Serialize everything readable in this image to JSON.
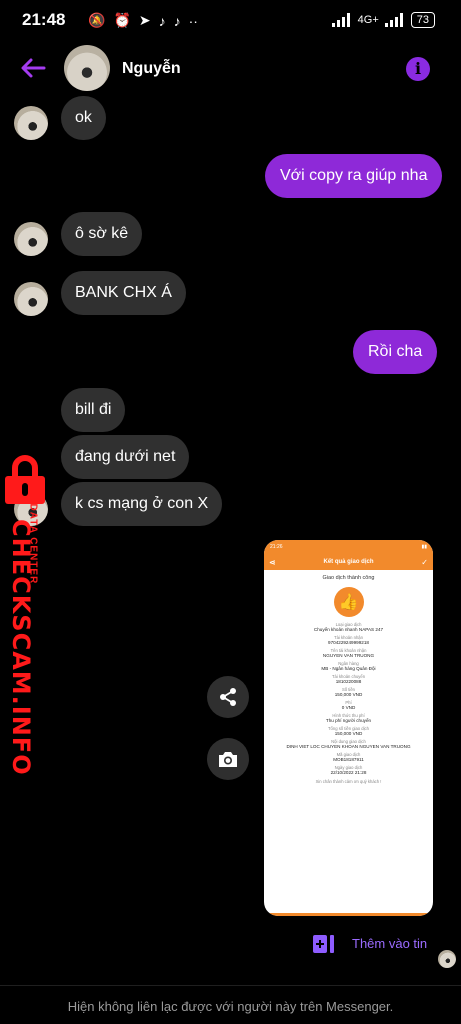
{
  "status_bar": {
    "time": "21:48",
    "network": "4G+",
    "battery": "73"
  },
  "header": {
    "contact_name": "Nguyễn",
    "back_icon": "arrow-left-icon",
    "info_icon": "info-icon",
    "accent_color": "#8e29d8"
  },
  "messages": [
    {
      "direction": "in",
      "text": "ok"
    },
    {
      "direction": "out",
      "text": "Với copy ra giúp nha"
    },
    {
      "direction": "in",
      "text": "ô sờ kê"
    },
    {
      "direction": "in",
      "text": "BANK CHX Á"
    },
    {
      "direction": "out",
      "text": "Rồi cha"
    },
    {
      "direction": "in",
      "text": "bill đi"
    },
    {
      "direction": "in",
      "text": "đang dưới net"
    },
    {
      "direction": "in",
      "text": "k cs mạng ở con X"
    }
  ],
  "receipt": {
    "time": "21:26",
    "title": "Kết quả giao dịch",
    "status": "Giao dịch thành công",
    "fields": [
      {
        "label": "Loại giao dịch",
        "value": "Chuyển khoản nhanh NAPAS 247"
      },
      {
        "label": "Tài khoản nhận",
        "value": "9704229249999218"
      },
      {
        "label": "Tên tài khoản nhận",
        "value": "NGUYEN VAN TRUONG"
      },
      {
        "label": "Ngân hàng",
        "value": "MB - Ngân hàng Quân Đội"
      },
      {
        "label": "Tài khoản chuyển",
        "value": "1810220088"
      },
      {
        "label": "Số tiền",
        "value": "150,000 VND"
      },
      {
        "label": "Phí",
        "value": "0 VND"
      },
      {
        "label": "Hình thức thu phí",
        "value": "Thu phí người chuyển"
      },
      {
        "label": "Tổng số tiền giao dịch",
        "value": "150,000 VND"
      },
      {
        "label": "Nội dung giao dịch",
        "value": "DINH VIET LOC CHUYEN KHOAN NGUYEN VAN TRUONG"
      },
      {
        "label": "Mã giao dịch",
        "value": "MOB18187911"
      },
      {
        "label": "Ngày giao dịch",
        "value": "22/10/2022 21:28"
      }
    ],
    "thanks": "Xin chân thành cảm ơn quý khách !"
  },
  "actions": {
    "share_icon": "share-icon",
    "camera_icon": "camera-icon"
  },
  "add_to_story": "Thêm vào tin",
  "footer": "Hiện không liên lạc được với người này trên Messenger.",
  "watermark": {
    "site": "CHECKSCAM.INFO",
    "sub": "DATA CENTER"
  }
}
